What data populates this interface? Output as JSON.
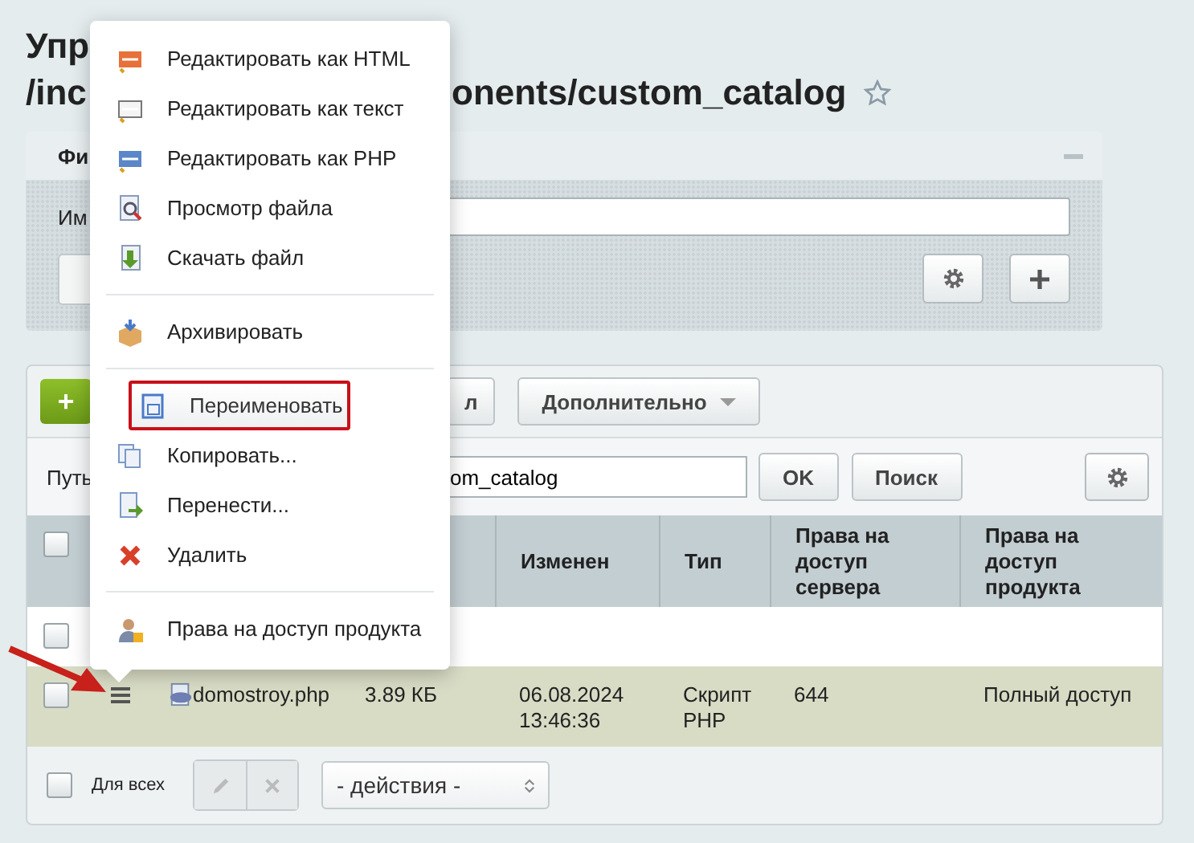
{
  "title": {
    "line_1": "Упр",
    "line_2_start": "/inc",
    "line_2_end": "onents/custom_catalog",
    "favorite": false
  },
  "filter": {
    "tab": "Фи",
    "name_label": "Им"
  },
  "toolbar": {
    "add_button": "+",
    "button_fragment": "л",
    "more_button": "Дополнительно"
  },
  "path": {
    "label": "Путь",
    "value": "om_catalog",
    "ok_button": "OK",
    "search_button": "Поиск"
  },
  "table": {
    "columns": [
      "",
      "",
      "",
      "",
      "Изменен",
      "Тип",
      "Права на доступ сервера",
      "Права на доступ продукта"
    ],
    "header_checked": false,
    "rows": [
      {
        "kind": "parent",
        "checked": false,
        "cells": []
      },
      {
        "kind": "file",
        "checked": false,
        "cells": [
          "",
          "",
          "domostroy.php",
          "3.89 КБ",
          "06.08.2024 13:46:36",
          "Скрипт PHP",
          "644",
          "Полный доступ"
        ]
      }
    ]
  },
  "footer": {
    "checked": false,
    "all_label": "Для всех",
    "actions_select": "- действия -"
  },
  "context_menu": {
    "groups": [
      [
        {
          "label": "Редактировать как HTML",
          "selected": false
        },
        {
          "label": "Редактировать как текст",
          "selected": false
        },
        {
          "label": "Редактировать как PHP",
          "selected": false
        },
        {
          "label": "Просмотр файла",
          "selected": false
        },
        {
          "label": "Скачать файл",
          "selected": false
        }
      ],
      [
        {
          "label": "Архивировать",
          "selected": false
        }
      ],
      [
        {
          "label": "Переименовать",
          "selected": true
        },
        {
          "label": "Копировать...",
          "selected": false
        },
        {
          "label": "Перенести...",
          "selected": false
        },
        {
          "label": "Удалить",
          "selected": false
        }
      ],
      [
        {
          "label": "Права на доступ продукта",
          "selected": false
        }
      ]
    ]
  }
}
